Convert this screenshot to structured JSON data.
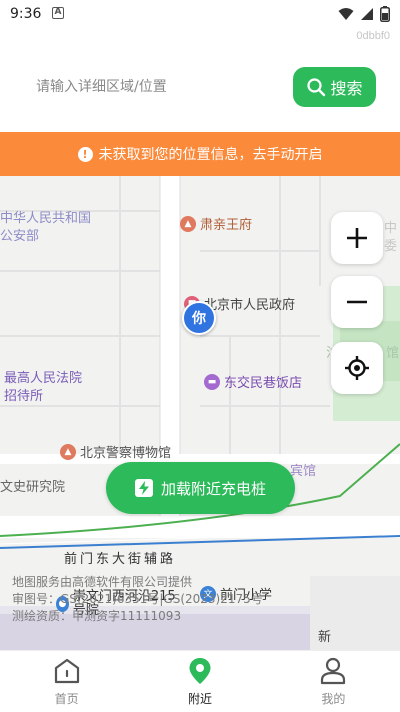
{
  "status": {
    "time": "9:36",
    "notification_glyph": "A"
  },
  "device_id": "0dbbf0",
  "search": {
    "placeholder": "请输入详细区域/位置",
    "button_label": "搜索"
  },
  "warning": {
    "text": "未获取到您的位置信息，去手动开启"
  },
  "map": {
    "user_marker": "你",
    "pois": [
      {
        "name": "肃亲王府",
        "color": "#e07a5f",
        "icon": "building-icon"
      },
      {
        "name": "北京市人民政府",
        "color": "#e0607a",
        "icon": "government-icon"
      },
      {
        "name": "东交民巷饭店",
        "color": "#a46ad0",
        "icon": "hotel-icon"
      },
      {
        "name": "北京警察博物馆",
        "color": "#e07a5f",
        "icon": "museum-icon"
      },
      {
        "name": "前门小学",
        "color": "#3b82d6",
        "icon": "school-icon"
      },
      {
        "name": "崇文门西河沿215号院",
        "color": "#3b82d6",
        "icon": "residence-icon"
      }
    ],
    "labels": {
      "ministry": "中华人民共和国\n公安部",
      "court": "最高人民法院\n招待所",
      "wenshi": "文史研究院",
      "road": "前门东大街辅路",
      "binguan": "宾馆",
      "right_top": "中\n委",
      "right_mid": "沽",
      "right_mid2": "馆",
      "xin": "新"
    },
    "load_button_label": "加载附近充电桩",
    "credits": [
      "地图服务由高德软件有限公司提供",
      "审图号：GS(2021)6351号|GS(2023)2175号",
      "测绘资质：甲测资字11111093"
    ]
  },
  "nav": [
    {
      "label": "首页",
      "icon": "home-icon",
      "active": false
    },
    {
      "label": "附近",
      "icon": "location-pin-icon",
      "active": true
    },
    {
      "label": "我的",
      "icon": "user-icon",
      "active": false
    }
  ],
  "colors": {
    "accent": "#2dba5b",
    "warning": "#fb8a3b",
    "marker": "#2f74e0"
  }
}
